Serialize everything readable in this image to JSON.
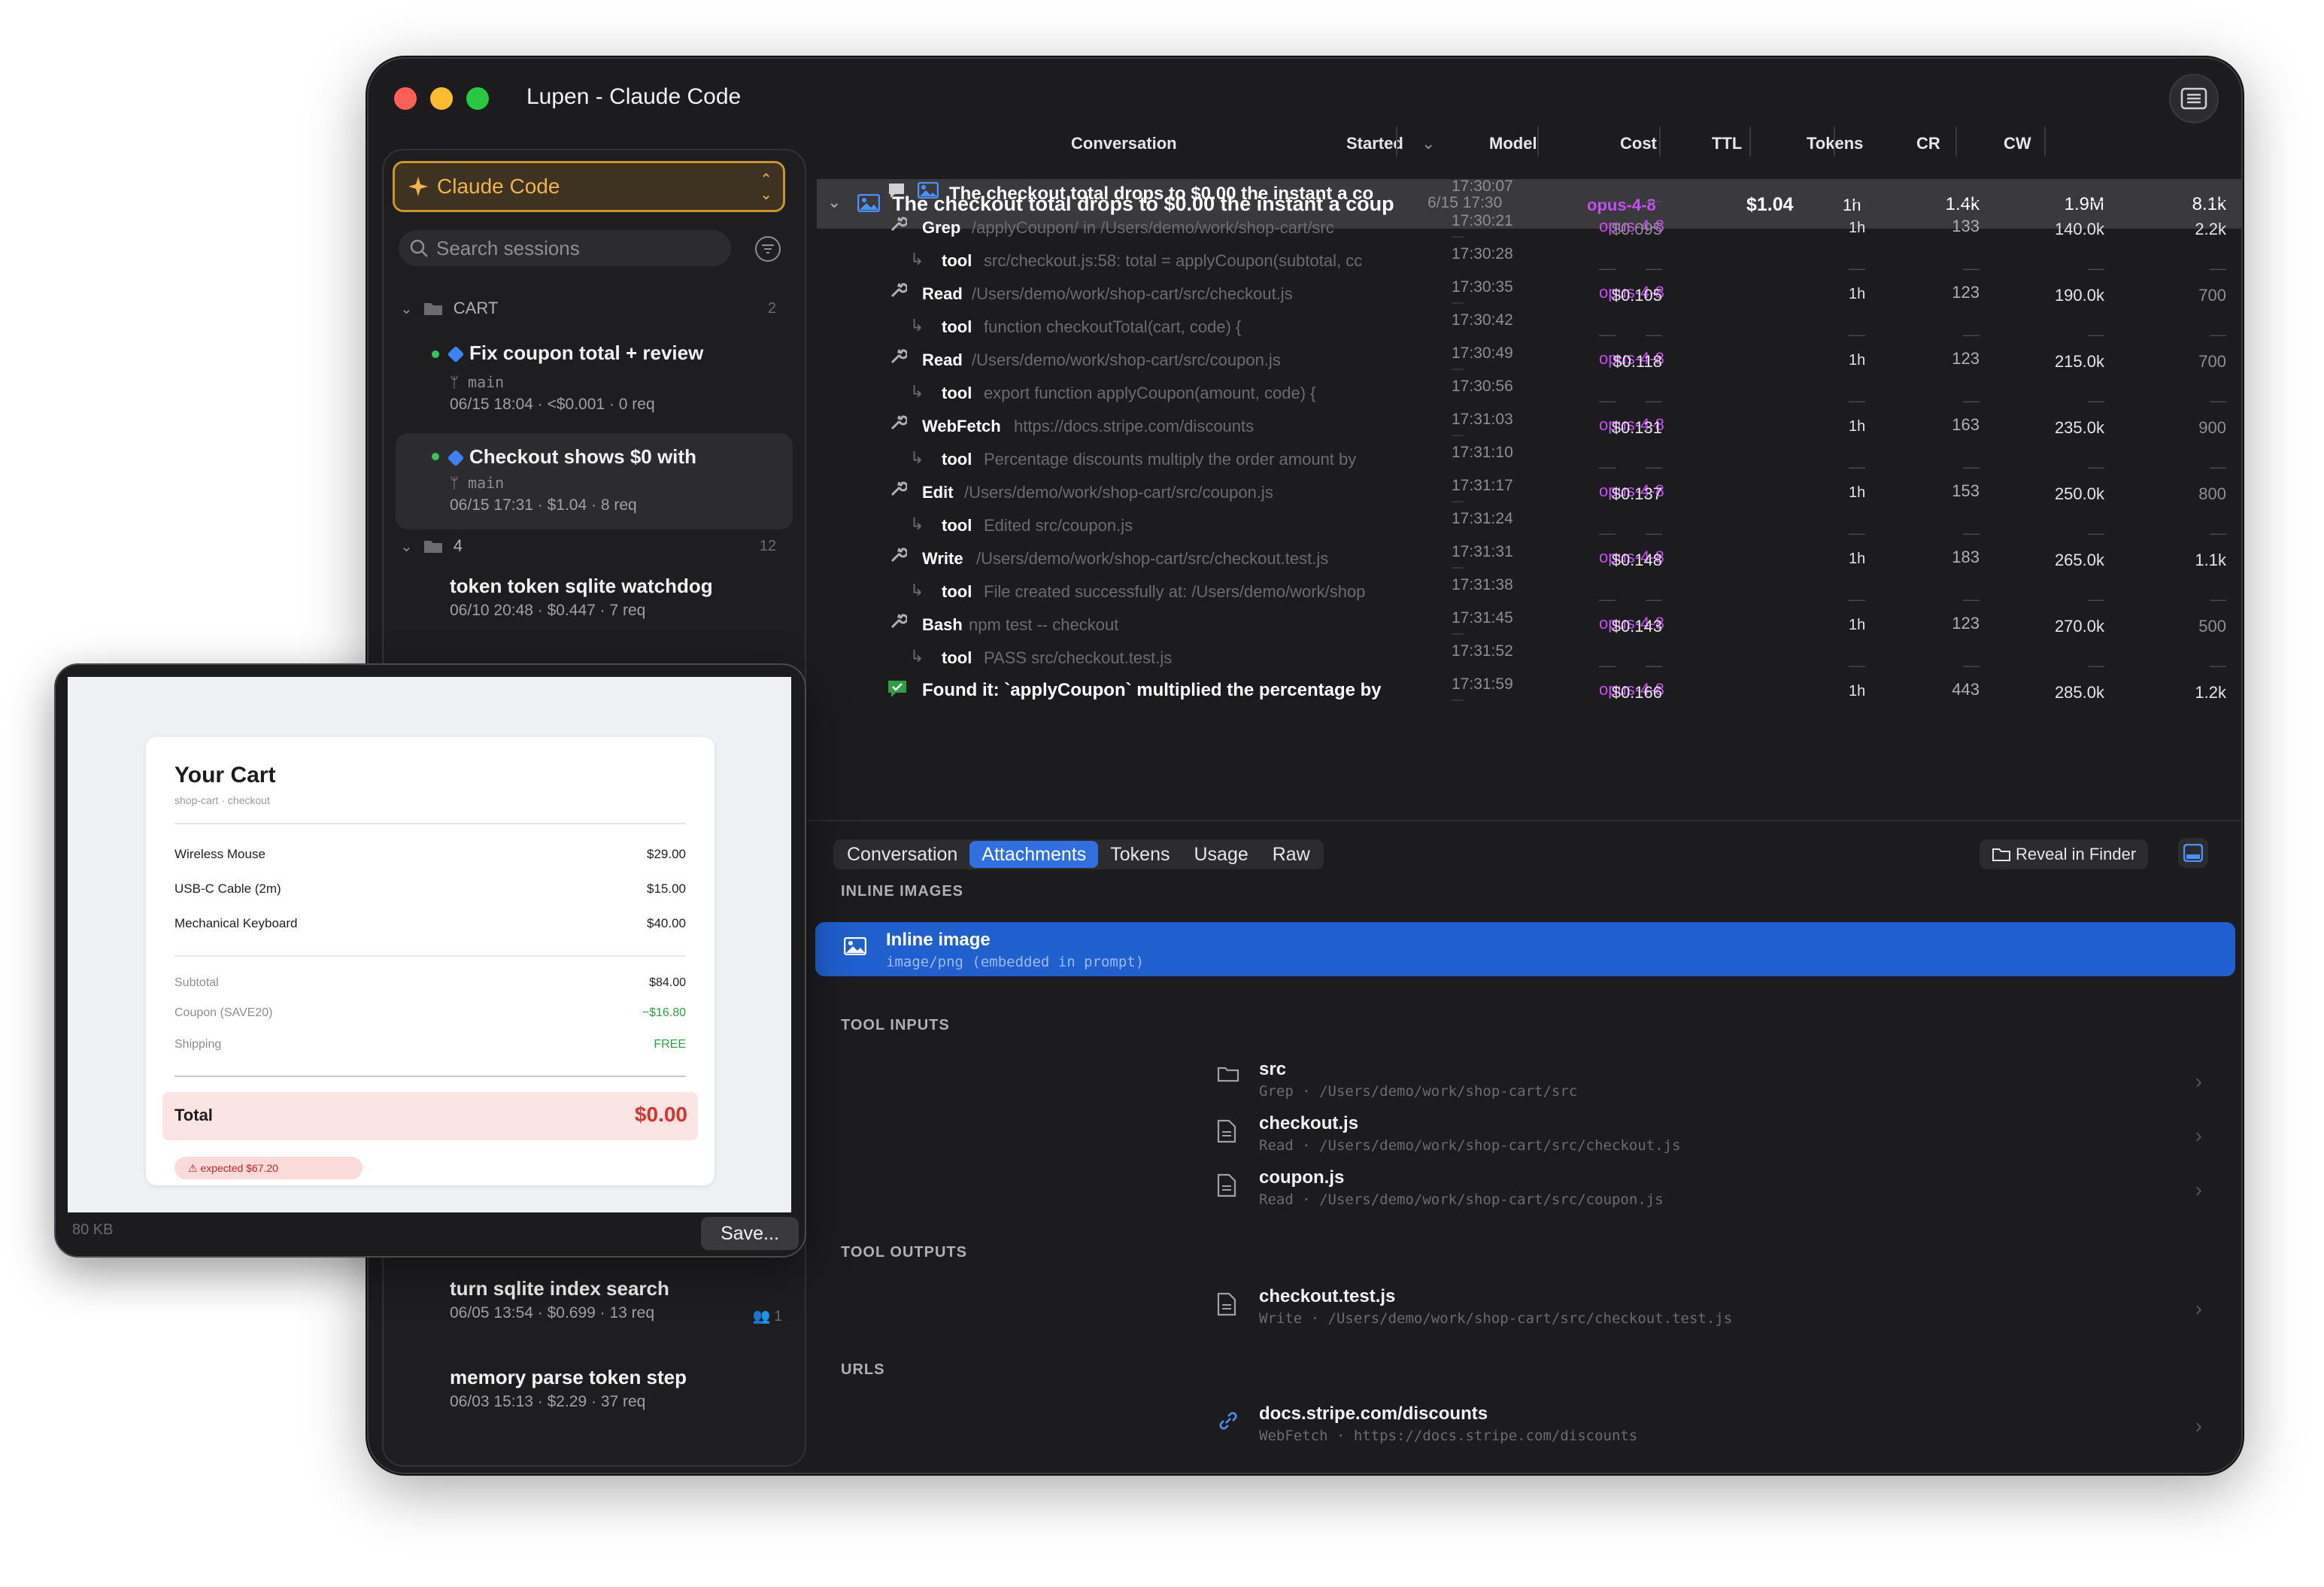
{
  "window": {
    "title": "Lupen - Claude Code"
  },
  "sidebar": {
    "picker_label": "Claude Code",
    "search_placeholder": "Search sessions",
    "groups": [
      {
        "name": "CART",
        "count": "2"
      },
      {
        "name": "4",
        "count": "12"
      }
    ],
    "sessions": [
      {
        "title": "Fix coupon total + review",
        "branch": "main",
        "meta": "06/15 18:04 · <$0.001 · 0 req"
      },
      {
        "title": "Checkout shows $0 with",
        "branch": "main",
        "meta": "06/15 17:31 · $1.04 · 8 req"
      },
      {
        "title": "token token sqlite watchdog",
        "meta": "06/10 20:48 · $0.447 · 7 req"
      },
      {
        "title": "turn sqlite index search",
        "meta": "06/05 13:54 · $0.699 · 13 req",
        "badge": "1"
      },
      {
        "title": "memory parse token step",
        "meta": "06/03 15:13 · $2.29 · 37 req"
      }
    ]
  },
  "table": {
    "headers": {
      "conversation": "Conversation",
      "started": "Started",
      "model": "Model",
      "cost": "Cost",
      "ttl": "TTL",
      "tokens": "Tokens",
      "cr": "CR",
      "cw": "CW"
    },
    "top_row": {
      "title": "The checkout total drops to $0.00 the instant a coup",
      "started": "6/15 17:30",
      "model": "opus-4-8",
      "cost": "$1.04",
      "ttl": "1h",
      "tokens": "1.4k",
      "cr": "1.9M",
      "cw": "8.1k"
    },
    "rows": [
      {
        "kind": "msg",
        "name": "The checkout total drops to $0.00 the instant a co",
        "time": "17:30:07"
      },
      {
        "kind": "call",
        "name": "Grep",
        "arg": "/applyCoupon/  in  /Users/demo/work/shop-cart/src",
        "time": "17:30:21",
        "model": "opus-4-8",
        "cost": "$0.095",
        "ttl": "1h",
        "tokens": "133",
        "cr": "140.0k",
        "cw": "2.2k"
      },
      {
        "kind": "tool",
        "name": "tool",
        "arg": "src/checkout.js:58: total = applyCoupon(subtotal, cc",
        "time": "17:30:28"
      },
      {
        "kind": "call",
        "name": "Read",
        "arg": "/Users/demo/work/shop-cart/src/checkout.js",
        "time": "17:30:35",
        "model": "opus-4-8",
        "cost": "$0.105",
        "ttl": "1h",
        "tokens": "123",
        "cr": "190.0k",
        "cw": "700"
      },
      {
        "kind": "tool",
        "name": "tool",
        "arg": "function checkoutTotal(cart, code) {",
        "time": "17:30:42"
      },
      {
        "kind": "call",
        "name": "Read",
        "arg": "/Users/demo/work/shop-cart/src/coupon.js",
        "time": "17:30:49",
        "model": "opus-4-8",
        "cost": "$0.118",
        "ttl": "1h",
        "tokens": "123",
        "cr": "215.0k",
        "cw": "700"
      },
      {
        "kind": "tool",
        "name": "tool",
        "arg": "export function applyCoupon(amount, code) {",
        "time": "17:30:56"
      },
      {
        "kind": "call",
        "name": "WebFetch",
        "arg": "https://docs.stripe.com/discounts",
        "time": "17:31:03",
        "model": "opus-4-8",
        "cost": "$0.131",
        "ttl": "1h",
        "tokens": "163",
        "cr": "235.0k",
        "cw": "900"
      },
      {
        "kind": "tool",
        "name": "tool",
        "arg": "Percentage discounts multiply the order amount by",
        "time": "17:31:10"
      },
      {
        "kind": "call",
        "name": "Edit",
        "arg": "/Users/demo/work/shop-cart/src/coupon.js",
        "time": "17:31:17",
        "model": "opus-4-8",
        "cost": "$0.137",
        "ttl": "1h",
        "tokens": "153",
        "cr": "250.0k",
        "cw": "800"
      },
      {
        "kind": "tool",
        "name": "tool",
        "arg": "Edited src/coupon.js",
        "time": "17:31:24"
      },
      {
        "kind": "call",
        "name": "Write",
        "arg": "/Users/demo/work/shop-cart/src/checkout.test.js",
        "time": "17:31:31",
        "model": "opus-4-8",
        "cost": "$0.148",
        "ttl": "1h",
        "tokens": "183",
        "cr": "265.0k",
        "cw": "1.1k"
      },
      {
        "kind": "tool",
        "name": "tool",
        "arg": "File created successfully at: /Users/demo/work/shop",
        "time": "17:31:38"
      },
      {
        "kind": "call",
        "name": "Bash",
        "arg": "npm test -- checkout",
        "time": "17:31:45",
        "model": "opus-4-8",
        "cost": "$0.143",
        "ttl": "1h",
        "tokens": "123",
        "cr": "270.0k",
        "cw": "500"
      },
      {
        "kind": "tool",
        "name": "tool",
        "arg": "PASS src/checkout.test.js",
        "time": "17:31:52"
      },
      {
        "kind": "final",
        "name": "Found it: `applyCoupon` multiplied the percentage by",
        "time": "17:31:59",
        "model": "opus-4-8",
        "cost": "$0.166",
        "ttl": "1h",
        "tokens": "443",
        "cr": "285.0k",
        "cw": "1.2k"
      }
    ],
    "dash": "—"
  },
  "detail": {
    "tabs": [
      "Conversation",
      "Attachments",
      "Tokens",
      "Usage",
      "Raw"
    ],
    "active_tab": "Attachments",
    "reveal_label": "Reveal in Finder",
    "sections": {
      "inline_images": "INLINE IMAGES",
      "tool_inputs": "TOOL INPUTS",
      "tool_outputs": "TOOL OUTPUTS",
      "urls": "URLS"
    },
    "inline_image": {
      "name": "Inline image",
      "sub": "image/png (embedded in prompt)"
    },
    "tool_inputs": [
      {
        "name": "src",
        "sub": "Grep  ·  /Users/demo/work/shop-cart/src",
        "icon": "folder-icon"
      },
      {
        "name": "checkout.js",
        "sub": "Read  ·  /Users/demo/work/shop-cart/src/checkout.js",
        "icon": "file-icon"
      },
      {
        "name": "coupon.js",
        "sub": "Read  ·  /Users/demo/work/shop-cart/src/coupon.js",
        "icon": "file-icon"
      }
    ],
    "tool_outputs": [
      {
        "name": "checkout.test.js",
        "sub": "Write  ·  /Users/demo/work/shop-cart/src/checkout.test.js",
        "icon": "file-icon"
      }
    ],
    "urls": [
      {
        "name": "docs.stripe.com/discounts",
        "sub": "WebFetch  ·  https://docs.stripe.com/discounts",
        "icon": "link-icon"
      }
    ]
  },
  "popover": {
    "size": "80 KB",
    "save_label": "Save...",
    "cart": {
      "title": "Your Cart",
      "subtitle": "shop-cart · checkout",
      "items": [
        {
          "name": "Wireless Mouse",
          "price": "$29.00"
        },
        {
          "name": "USB-C Cable (2m)",
          "price": "$15.00"
        },
        {
          "name": "Mechanical Keyboard",
          "price": "$40.00"
        }
      ],
      "subtotal_label": "Subtotal",
      "subtotal": "$84.00",
      "coupon_label": "Coupon (SAVE20)",
      "coupon": "−$16.80",
      "shipping_label": "Shipping",
      "shipping": "FREE",
      "total_label": "Total",
      "total": "$0.00",
      "warning": "⚠ expected $67.20"
    }
  },
  "colors": {
    "accent": "#2f6fe0",
    "model": "#c94ef5",
    "picker": "#f0b24a",
    "green": "#34c759"
  }
}
